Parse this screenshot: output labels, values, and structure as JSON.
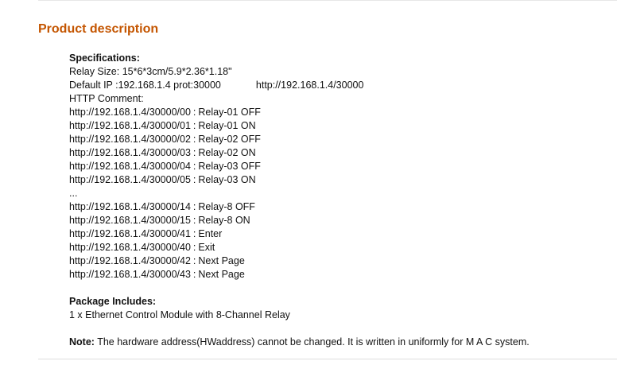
{
  "section": {
    "title": "Product description"
  },
  "specifications": {
    "heading": "Specifications:",
    "relay_size": "Relay Size: 15*6*3cm/5.9*2.36*1.18\"",
    "default_ip_label": "Default IP :192.168.1.4  prot:30000",
    "default_ip_url": "http://192.168.1.4/30000",
    "http_comment": "HTTP Comment:",
    "commands_a": [
      {
        "url": "http://192.168.1.4/30000/00",
        "action": "Relay-01 OFF"
      },
      {
        "url": "http://192.168.1.4/30000/01",
        "action": "Relay-01 ON"
      },
      {
        "url": "http://192.168.1.4/30000/02",
        "action": "Relay-02 OFF"
      },
      {
        "url": "http://192.168.1.4/30000/03",
        "action": "Relay-02 ON"
      },
      {
        "url": "http://192.168.1.4/30000/04",
        "action": "Relay-03 OFF"
      },
      {
        "url": "http://192.168.1.4/30000/05",
        "action": "Relay-03 ON"
      }
    ],
    "ellipsis": "...",
    "commands_b": [
      {
        "url": "http://192.168.1.4/30000/14",
        "action": "Relay-8 OFF"
      },
      {
        "url": "http://192.168.1.4/30000/15",
        "action": "Relay-8 ON"
      },
      {
        "url": "http://192.168.1.4/30000/41",
        "action": "Enter"
      },
      {
        "url": "http://192.168.1.4/30000/40",
        "action": "Exit"
      },
      {
        "url": "http://192.168.1.4/30000/42",
        "action": "Next Page"
      },
      {
        "url": "http://192.168.1.4/30000/43",
        "action": "Next Page"
      }
    ],
    "separator": ":"
  },
  "package": {
    "heading": "Package Includes:",
    "item": "1 x Ethernet Control Module with 8-Channel Relay"
  },
  "note": {
    "label": "Note:",
    "text": "The hardware address(HWaddress) cannot be changed. It is written in uniformly for M A C system."
  },
  "colors": {
    "title": "#c45500",
    "text": "#111111"
  }
}
